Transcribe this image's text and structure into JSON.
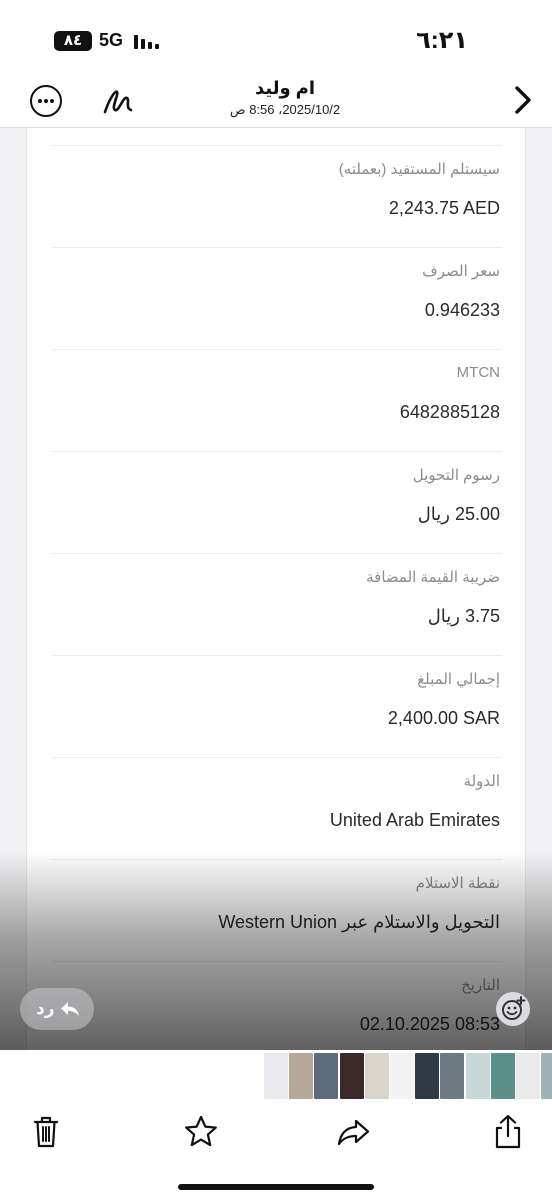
{
  "status_bar": {
    "battery": "٨٤",
    "network": "5G",
    "time": "٦:٢١"
  },
  "header": {
    "contact_name": "ام وليد",
    "message_date": "2025/10/2، 8:56 ص",
    "icons": {
      "more": "more-dots-icon",
      "markup": "markup-pen-icon",
      "back": "chevron-right-icon"
    }
  },
  "details": [
    {
      "label": "سيستلم المستفيد (بعملته)",
      "value": "2,243.75 AED"
    },
    {
      "label": "سعر الصرف",
      "value": "0.946233"
    },
    {
      "label": "MTCN",
      "value": "6482885128"
    },
    {
      "label": "رسوم التحويل",
      "value": "25.00 ريال"
    },
    {
      "label": "ضريبة القيمة المضافة",
      "value": "3.75 ريال"
    },
    {
      "label": "إجمالي المبلغ",
      "value": "2,400.00 SAR"
    },
    {
      "label": "الدولة",
      "value": "United Arab Emirates"
    },
    {
      "label": "نقطة الاستلام",
      "value": "التحويل والاستلام عبر Western Union"
    },
    {
      "label": "التاريخ",
      "value": "02.10.2025 08:53"
    }
  ],
  "overlay": {
    "reply_label": "رد",
    "reply_icon": "reply-arrow-icon",
    "emoji_icon": "add-reaction-icon"
  },
  "thumbnails": {
    "colors": [
      "#e9e9ee",
      "#b7a79a",
      "#5d6b7a",
      "#3a2a2a",
      "#d9d4cc",
      "#f2f2f2",
      "#2f3a44",
      "#6f7b83",
      "#c8d8d8",
      "#5a8f8a",
      "#eaeaea",
      "#9fb1b4",
      "#eeeeee",
      "#1c1c1c"
    ]
  },
  "toolbar": {
    "icons": [
      "trash-icon",
      "star-icon",
      "forward-icon",
      "share-icon"
    ]
  }
}
